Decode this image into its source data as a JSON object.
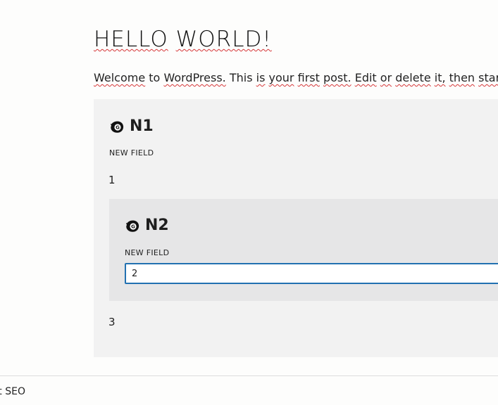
{
  "post": {
    "title_word_1": "HELLO",
    "title_word_2": "WORLD!",
    "body": {
      "w1": "Welcome",
      "w2": "to",
      "w3": "WordPress.",
      "w4": "This",
      "w5": "is",
      "w6": "your",
      "w7": "first",
      "w8": "post.",
      "w9": "Edit",
      "w10": "or",
      "w11": "delete",
      "w12": "it,",
      "w13": "then",
      "w14": "start"
    }
  },
  "block_n1": {
    "title": "N1",
    "icon": "genesis-block-icon",
    "field_label": "NEW FIELD",
    "value_top": "1",
    "value_bottom": "3"
  },
  "block_n2": {
    "title": "N2",
    "icon": "genesis-block-icon",
    "field_label": "NEW FIELD",
    "input_value": "2"
  },
  "footer": {
    "text": "st SEO"
  },
  "colors": {
    "input_focus_border": "#2271b1",
    "outer_block_bg": "#f2f2f2",
    "inner_block_bg": "#e6e6e7",
    "spellcheck_underline": "#d63638"
  }
}
